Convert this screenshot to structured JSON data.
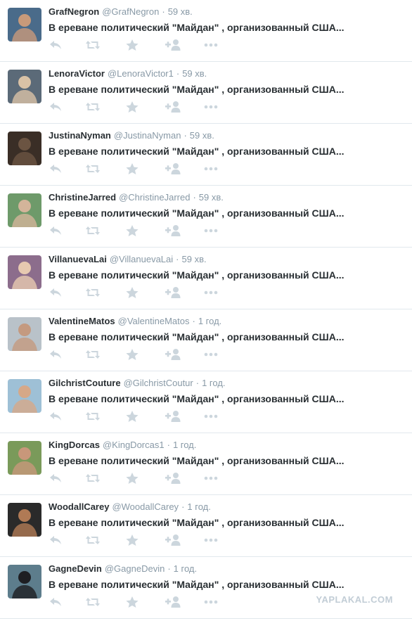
{
  "tweets": [
    {
      "name": "GrafNegron",
      "handle": "@GrafNegron",
      "time": "59 хв.",
      "text": "В ереване политический \"Майдан\" , организованный США...",
      "avatar_bg": "#4a6b8a",
      "avatar_fg": "#c89a7a"
    },
    {
      "name": "LenoraVictor",
      "handle": "@LenoraVictor1",
      "time": "59 хв.",
      "text": "В ереване политический \"Майдан\" , организованный США...",
      "avatar_bg": "#5b6a78",
      "avatar_fg": "#d9c2a6"
    },
    {
      "name": "JustinaNyman",
      "handle": "@JustinaNyman",
      "time": "59 хв.",
      "text": "В ереване политический \"Майдан\" , организованный США...",
      "avatar_bg": "#3a2e26",
      "avatar_fg": "#6b5442"
    },
    {
      "name": "ChristineJarred",
      "handle": "@ChristineJarred",
      "time": "59 хв.",
      "text": "В ереване политический \"Майдан\" , организованный США...",
      "avatar_bg": "#6e9a6a",
      "avatar_fg": "#d3b49a"
    },
    {
      "name": "VillanuevaLai",
      "handle": "@VillanuevaLai",
      "time": "59 хв.",
      "text": "В ереване политический \"Майдан\" , организованный США...",
      "avatar_bg": "#8c6d8c",
      "avatar_fg": "#e7c9b0"
    },
    {
      "name": "ValentineMatos",
      "handle": "@ValentineMatos",
      "time": "1 год.",
      "text": "В ереване политический \"Майдан\" , организованный США...",
      "avatar_bg": "#b9c2c9",
      "avatar_fg": "#c49a80"
    },
    {
      "name": "GilchristCouture",
      "handle": "@GilchristCoutur",
      "time": "1 год.",
      "text": "В ереване политический \"Майдан\" , организованный США...",
      "avatar_bg": "#9ec0d6",
      "avatar_fg": "#d6a888"
    },
    {
      "name": "KingDorcas",
      "handle": "@KingDorcas1",
      "time": "1 год.",
      "text": "В ереване политический \"Майдан\" , организованный США...",
      "avatar_bg": "#7a9a5a",
      "avatar_fg": "#c8977a"
    },
    {
      "name": "WoodallCarey",
      "handle": "@WoodallCarey",
      "time": "1 год.",
      "text": "В ереване политический \"Майдан\" , организованный США...",
      "avatar_bg": "#2a2a2a",
      "avatar_fg": "#b07a55"
    },
    {
      "name": "GagneDevin",
      "handle": "@GagneDevin",
      "time": "1 год.",
      "text": "В ереване политический \"Майдан\" , организованный США...",
      "avatar_bg": "#5d7d8c",
      "avatar_fg": "#1e1e22"
    }
  ],
  "separator": "·",
  "watermark": "YAPLAKAL.COM",
  "icons": [
    "reply-icon",
    "retweet-icon",
    "favorite-icon",
    "follow-icon",
    "more-icon"
  ],
  "colors": {
    "name": "#292f33",
    "muted": "#8899a6",
    "icon": "#ccd6dd",
    "border": "#e1e8ed",
    "watermark": "#c2cdd6"
  }
}
